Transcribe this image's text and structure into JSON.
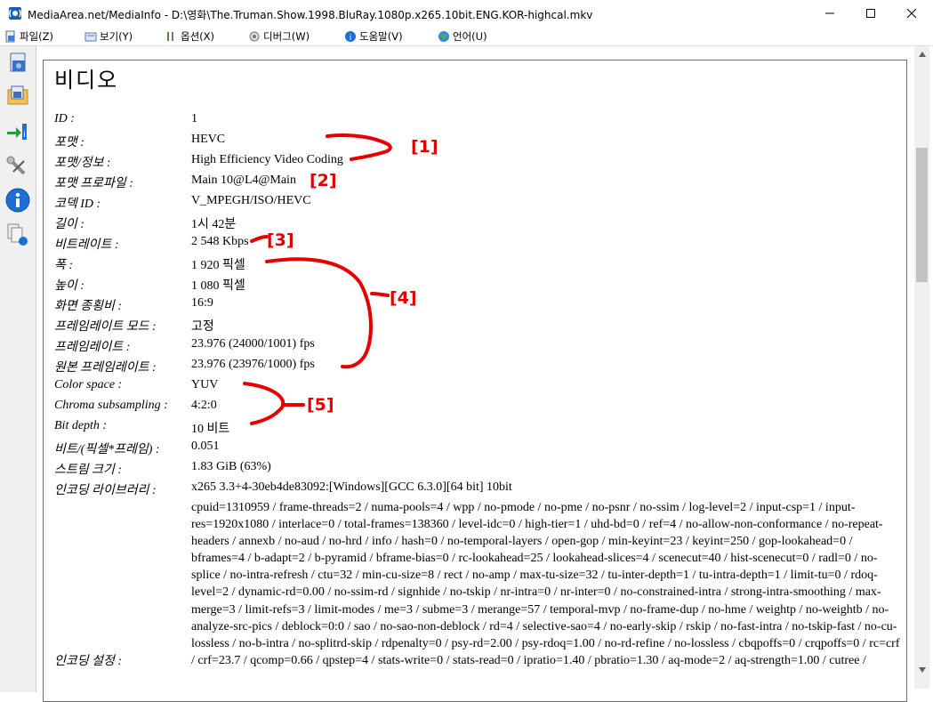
{
  "window": {
    "title": "MediaArea.net/MediaInfo - D:\\영화\\The.Truman.Show.1998.BluRay.1080p.x265.10bit.ENG.KOR-highcal.mkv",
    "accent": "#1a6fd6"
  },
  "menu": [
    {
      "label": "파일(Z)",
      "icon": "file-icon"
    },
    {
      "label": "보기(Y)",
      "icon": "view-icon"
    },
    {
      "label": "옵션(X)",
      "icon": "options-icon"
    },
    {
      "label": "디버그(W)",
      "icon": "debug-icon"
    },
    {
      "label": "도움말(V)",
      "icon": "help-icon"
    },
    {
      "label": "언어(U)",
      "icon": "language-icon"
    }
  ],
  "toolbar": [
    "open-file-icon",
    "open-folder-icon",
    "export-icon",
    "preferences-icon",
    "about-icon",
    "multiple-files-icon"
  ],
  "section": {
    "title": "비디오"
  },
  "rows": [
    {
      "label": "ID :",
      "value": "1"
    },
    {
      "label": "포맷 :",
      "value": "HEVC"
    },
    {
      "label": "포맷/정보 :",
      "value": "High Efficiency Video Coding"
    },
    {
      "label": "포맷 프로파일 :",
      "value": "Main 10@L4@Main"
    },
    {
      "label": "코덱 ID :",
      "value": "V_MPEGH/ISO/HEVC"
    },
    {
      "label": "길이 :",
      "value": "1시 42분"
    },
    {
      "label": "비트레이트 :",
      "value": "2 548 Kbps"
    },
    {
      "label": "폭 :",
      "value": "1 920 픽셀"
    },
    {
      "label": "높이 :",
      "value": "1 080 픽셀"
    },
    {
      "label": "화면 종횡비 :",
      "value": "16:9"
    },
    {
      "label": "프레임레이트 모드 :",
      "value": "고정"
    },
    {
      "label": "프레임레이트 :",
      "value": "23.976 (24000/1001) fps"
    },
    {
      "label": "원본 프레임레이트 :",
      "value": "23.976 (23976/1000) fps"
    },
    {
      "label": "Color space :",
      "value": "YUV"
    },
    {
      "label": "Chroma subsampling :",
      "value": "4:2:0"
    },
    {
      "label": "Bit depth :",
      "value": "10 비트"
    },
    {
      "label": "비트/(픽셀*프레임) :",
      "value": "0.051"
    },
    {
      "label": "스트림 크기 :",
      "value": "1.83 GiB (63%)"
    },
    {
      "label": "인코딩 라이브러리 :",
      "value": "x265 3.3+4-30eb4de83092:[Windows][GCC 6.3.0][64 bit] 10bit"
    }
  ],
  "encoding_settings": {
    "label": "인코딩 설정 :",
    "value": "cpuid=1310959 / frame-threads=2 / numa-pools=4 / wpp / no-pmode / no-pme / no-psnr / no-ssim / log-level=2 / input-csp=1 / input-res=1920x1080 / interlace=0 / total-frames=138360 / level-idc=0 / high-tier=1 / uhd-bd=0 / ref=4 / no-allow-non-conformance / no-repeat-headers / annexb / no-aud / no-hrd / info / hash=0 / no-temporal-layers / open-gop / min-keyint=23 / keyint=250 / gop-lookahead=0 / bframes=4 / b-adapt=2 / b-pyramid / bframe-bias=0 / rc-lookahead=25 / lookahead-slices=4 / scenecut=40 / hist-scenecut=0 / radl=0 / no-splice / no-intra-refresh / ctu=32 / min-cu-size=8 / rect / no-amp / max-tu-size=32 / tu-inter-depth=1 / tu-intra-depth=1 / limit-tu=0 / rdoq-level=2 / dynamic-rd=0.00 / no-ssim-rd / signhide / no-tskip / nr-intra=0 / nr-inter=0 / no-constrained-intra / strong-intra-smoothing / max-merge=3 / limit-refs=3 / limit-modes / me=3 / subme=3 / merange=57 / temporal-mvp / no-frame-dup / no-hme / weightp / no-weightb / no-analyze-src-pics / deblock=0:0 / sao / no-sao-non-deblock / rd=4 / selective-sao=4 / no-early-skip / rskip / no-fast-intra / no-tskip-fast / no-cu-lossless / no-b-intra / no-splitrd-skip / rdpenalty=0 / psy-rd=2.00 / psy-rdoq=1.00 / no-rd-refine / no-lossless / cbqpoffs=0 / crqpoffs=0 / rc=crf / crf=23.7 / qcomp=0.66 / qpstep=4 / stats-write=0 / stats-read=0 / ipratio=1.40 / pbratio=1.30 / aq-mode=2 / aq-strength=1.00 / cutree /"
  },
  "annotations": [
    "[1]",
    "[2]",
    "[3]",
    "[4]",
    "[5]"
  ]
}
